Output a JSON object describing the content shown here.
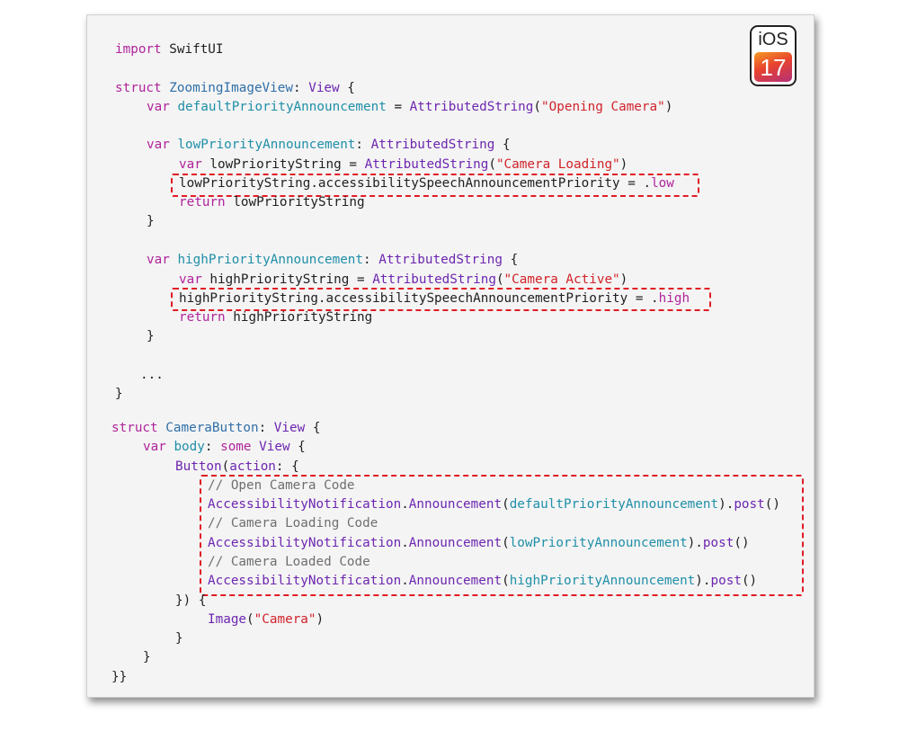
{
  "badge": {
    "top": "iOS",
    "number": "17"
  },
  "code": {
    "l1": {
      "a": "import",
      "b": " SwiftUI"
    },
    "l2": {
      "a": "struct",
      "b": " ",
      "c": "ZoomingImageView",
      "d": ": ",
      "e": "View",
      "f": " {"
    },
    "l3": {
      "a": "var",
      "b": " ",
      "c": "defaultPriorityAnnouncement",
      "d": " = ",
      "e": "AttributedString",
      "f": "(",
      "g": "\"Opening Camera\"",
      "h": ")"
    },
    "l4": {
      "a": "var",
      "b": " ",
      "c": "lowPriorityAnnouncement",
      "d": ": ",
      "e": "AttributedString",
      "f": " {"
    },
    "l5": {
      "a": "var",
      "b": " lowPriorityString = ",
      "c": "AttributedString",
      "d": "(",
      "e": "\"Camera Loading\"",
      "f": ")"
    },
    "l6": {
      "a": "lowPriorityString.accessibilitySpeechAnnouncementPriority = .",
      "b": "low"
    },
    "l7": {
      "a": "return",
      "b": " lowPriorityString"
    },
    "l8": "}",
    "l9": {
      "a": "var",
      "b": " ",
      "c": "highPriorityAnnouncement",
      "d": ": ",
      "e": "AttributedString",
      "f": " {"
    },
    "l10": {
      "a": "var",
      "b": " highPriorityString = ",
      "c": "AttributedString",
      "d": "(",
      "e": "\"Camera Active\"",
      "f": ")"
    },
    "l11": {
      "a": "highPriorityString.accessibilitySpeechAnnouncementPriority = .",
      "b": "high"
    },
    "l12": {
      "a": "return",
      "b": " highPriorityString"
    },
    "l13": "}",
    "l14": "...",
    "l15": "}",
    "l16": {
      "a": "struct",
      "b": " ",
      "c": "CameraButton",
      "d": ": ",
      "e": "View",
      "f": " {"
    },
    "l17": {
      "a": "var",
      "b": " ",
      "c": "body",
      "d": ": ",
      "e": "some",
      "f": " ",
      "g": "View",
      "h": " {"
    },
    "l18": {
      "a": "Button",
      "b": "(",
      "c": "action",
      "d": ": {"
    },
    "l19": "// Open Camera Code",
    "l20": {
      "a": "AccessibilityNotification",
      "b": ".",
      "c": "Announcement",
      "d": "(",
      "e": "defaultPriorityAnnouncement",
      "f": ").",
      "g": "post",
      "h": "()"
    },
    "l21": "// Camera Loading Code",
    "l22": {
      "a": "AccessibilityNotification",
      "b": ".",
      "c": "Announcement",
      "d": "(",
      "e": "lowPriorityAnnouncement",
      "f": ").",
      "g": "post",
      "h": "()"
    },
    "l23": "// Camera Loaded Code",
    "l24": {
      "a": "AccessibilityNotification",
      "b": ".",
      "c": "Announcement",
      "d": "(",
      "e": "highPriorityAnnouncement",
      "f": ").",
      "g": "post",
      "h": "()"
    },
    "l25": "}) {",
    "l26": {
      "a": "Image",
      "b": "(",
      "c": "\"Camera\"",
      "d": ")"
    },
    "l27": "}",
    "l28": "}",
    "l29": "}}"
  }
}
